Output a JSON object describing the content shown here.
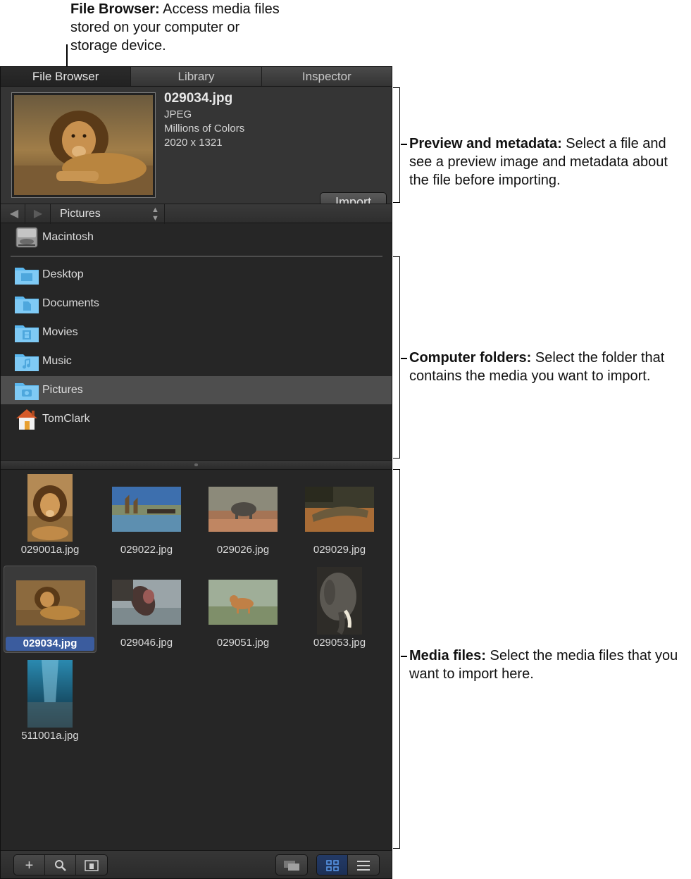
{
  "callouts": {
    "file_browser": {
      "title": "File Browser:",
      "text": " Access media files stored on your computer or storage device."
    },
    "preview": {
      "title": "Preview and metadata:",
      "text": " Select a file and see a preview image and metadata about the file before importing."
    },
    "folders": {
      "title": "Computer folders:",
      "text": " Select the folder that contains the media you want to import."
    },
    "media": {
      "title": "Media files:",
      "text": " Select the media files that you want to import here."
    }
  },
  "tabs": [
    "File Browser",
    "Library",
    "Inspector"
  ],
  "active_tab": "File Browser",
  "preview": {
    "filename": "029034.jpg",
    "format": "JPEG",
    "colors": "Millions of Colors",
    "dimensions": "2020 x 1321",
    "import_label": "Import"
  },
  "navbar": {
    "back_icon": "back-arrow-icon",
    "forward_icon": "forward-arrow-icon",
    "location": "Pictures"
  },
  "sources": [
    {
      "label": "Macintosh",
      "icon": "hard-drive-icon"
    }
  ],
  "folders": [
    {
      "label": "Desktop",
      "icon": "desktop-folder-icon"
    },
    {
      "label": "Documents",
      "icon": "documents-folder-icon"
    },
    {
      "label": "Movies",
      "icon": "movies-folder-icon"
    },
    {
      "label": "Music",
      "icon": "music-folder-icon"
    },
    {
      "label": "Pictures",
      "icon": "pictures-folder-icon",
      "selected": true
    },
    {
      "label": "TomClark",
      "icon": "home-icon"
    }
  ],
  "media": [
    {
      "name": "029001a.jpg",
      "subject": "lion-portrait"
    },
    {
      "name": "029022.jpg",
      "subject": "giraffes-waterhole"
    },
    {
      "name": "029026.jpg",
      "subject": "rhino"
    },
    {
      "name": "029029.jpg",
      "subject": "crocodile"
    },
    {
      "name": "029034.jpg",
      "subject": "lion-lying",
      "selected": true
    },
    {
      "name": "029046.jpg",
      "subject": "hippo"
    },
    {
      "name": "029051.jpg",
      "subject": "lioness"
    },
    {
      "name": "029053.jpg",
      "subject": "elephant"
    },
    {
      "name": "511001a.jpg",
      "subject": "underwater-fish"
    }
  ],
  "bottombar": {
    "left_buttons": [
      "add-icon",
      "search-icon",
      "preview-icon"
    ],
    "right_buttons": [
      "stack-icon",
      "grid-view-icon",
      "list-view-icon"
    ],
    "active_view": "grid-view-icon"
  },
  "colors": {
    "panel_bg": "#262626",
    "selection_blue": "#3b5c9e",
    "folder_blue": "#5bb7ee"
  }
}
